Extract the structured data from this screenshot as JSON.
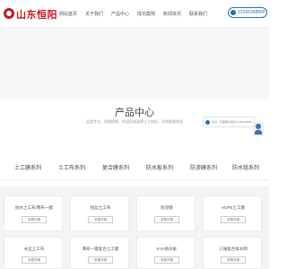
{
  "header": {
    "logo_text": "山东恒阳",
    "nav": [
      "网站首页",
      "关于我们",
      "产品中心",
      "成功案例",
      "新闻资讯",
      "联系我们"
    ],
    "phone": "13165348890"
  },
  "hero": {
    "title": "产品中心",
    "subtitle": "品类齐全，质量保障，欢迎您来选择土工材料，详询客服电话"
  },
  "notify": {
    "text": "您好，有需要请拨打13165348890"
  },
  "categories": [
    "土工膜系列",
    "土工布系列",
    "复合膜系列",
    "防水板系列",
    "防渗膜系列",
    "防水毯系列"
  ],
  "products": [
    {
      "title": "防水土工布/两布一膜",
      "button": "查看详情"
    },
    {
      "title": "短丝土工布",
      "button": "查看详情"
    },
    {
      "title": "防渗膜",
      "button": "查看详情"
    },
    {
      "title": "HDPE土工膜",
      "button": "查看详情"
    },
    {
      "title": "长丝土工布",
      "button": "查看详情"
    },
    {
      "title": "两布一膜复合土工膜",
      "button": "查看详情"
    },
    {
      "title": "EVA防水板",
      "button": "查看详情"
    },
    {
      "title": "三维复合排水网",
      "button": "查看详情"
    }
  ]
}
